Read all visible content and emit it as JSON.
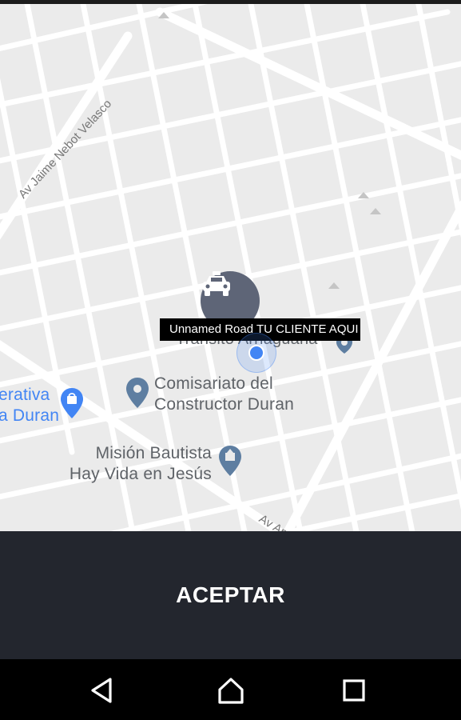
{
  "map": {
    "roads": [
      {
        "name": "Av Jaime Nebot Velasco"
      },
      {
        "name": "Av Am"
      }
    ],
    "pois": [
      {
        "name_line1": "Comisariato del",
        "name_line2": "Constructor Duran",
        "icon": "pin-icon",
        "color": "#5e7ea1"
      },
      {
        "name_line1": "Misión Bautista",
        "name_line2": "Hay Vida en Jesús",
        "icon": "church-icon",
        "color": "#5e7ea1"
      },
      {
        "name_line1": "erativa",
        "name_line2": "a Duran",
        "icon": "shopping-bag-icon",
        "color": "#4285f4"
      },
      {
        "name_line1": "Tránsito Arriaguana",
        "icon": "pin-icon",
        "color": "#5e7ea1"
      }
    ],
    "marker": {
      "icon": "taxi-icon",
      "color": "#5e6577"
    },
    "info_label": "Unnamed Road TU CLIENTE AQUI",
    "my_location": {
      "icon": "my-location-dot",
      "color": "#4285f4"
    }
  },
  "action": {
    "accept_label": "ACEPTAR",
    "background": "#23262e"
  },
  "navbar": {
    "back_icon": "back-triangle-icon",
    "home_icon": "home-icon",
    "recents_icon": "recents-square-icon"
  }
}
